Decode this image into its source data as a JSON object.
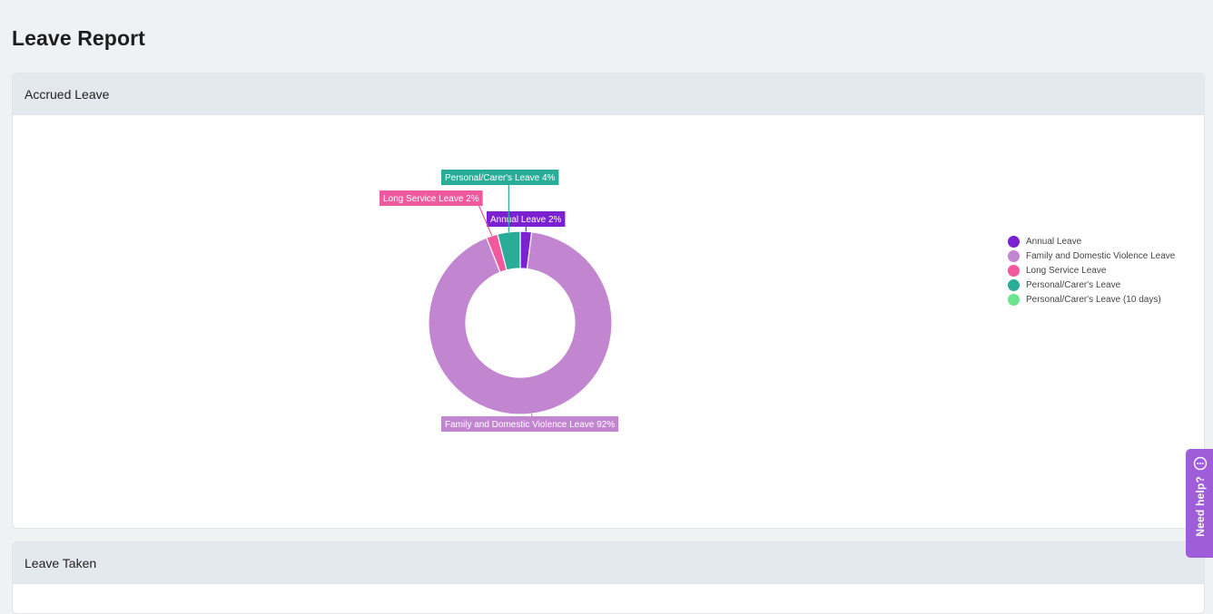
{
  "page": {
    "title": "Leave Report"
  },
  "sections": {
    "accrued": {
      "title": "Accrued Leave"
    },
    "taken": {
      "title": "Leave Taken"
    }
  },
  "help": {
    "label": "Need help?"
  },
  "chart_data": {
    "type": "pie",
    "variant": "donut",
    "title": "",
    "slices": [
      {
        "name": "Annual Leave",
        "value": 2,
        "label": "Annual Leave 2%",
        "color": "#7a22d1"
      },
      {
        "name": "Family and Domestic Violence Leave",
        "value": 92,
        "label": "Family and Domestic Violence Leave 92%",
        "color": "#c286d0"
      },
      {
        "name": "Long Service Leave",
        "value": 2,
        "label": "Long Service Leave 2%",
        "color": "#f0599e"
      },
      {
        "name": "Personal/Carer's Leave",
        "value": 4,
        "label": "Personal/Carer's Leave 4%",
        "color": "#2aad98"
      }
    ],
    "legend": [
      {
        "name": "Annual Leave",
        "color": "#7a22d1"
      },
      {
        "name": "Family and Domestic Violence Leave",
        "color": "#c286d0"
      },
      {
        "name": "Long Service Leave",
        "color": "#f0599e"
      },
      {
        "name": "Personal/Carer's Leave",
        "color": "#2aad98"
      },
      {
        "name": "Personal/Carer's Leave (10 days)",
        "color": "#6be58d"
      }
    ],
    "legend_position": "right"
  }
}
